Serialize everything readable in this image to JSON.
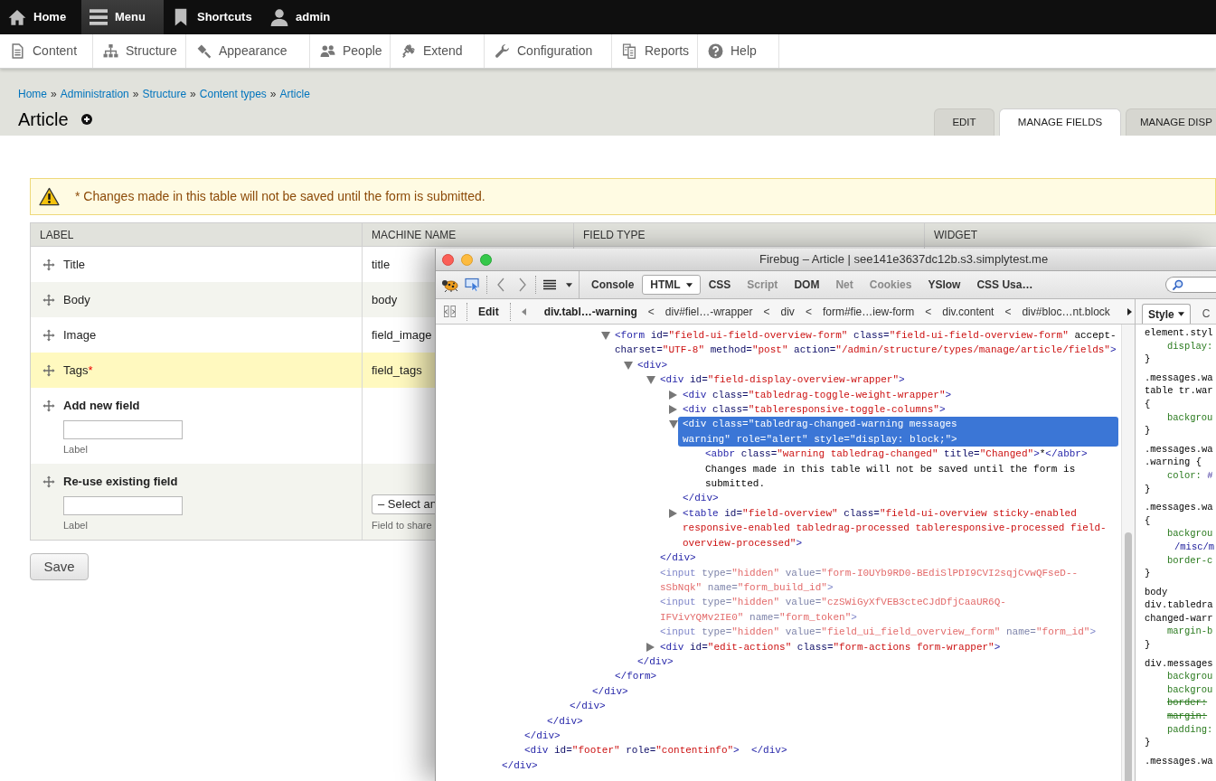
{
  "toolbar": {
    "items": [
      {
        "label": "Home",
        "selected": false
      },
      {
        "label": "Menu",
        "selected": true
      },
      {
        "label": "Shortcuts",
        "selected": false
      },
      {
        "label": "admin",
        "selected": false
      }
    ]
  },
  "tray": {
    "items": [
      {
        "label": "Content"
      },
      {
        "label": "Structure"
      },
      {
        "label": "Appearance"
      },
      {
        "label": "People"
      },
      {
        "label": "Extend"
      },
      {
        "label": "Configuration"
      },
      {
        "label": "Reports"
      },
      {
        "label": "Help"
      }
    ]
  },
  "breadcrumb": {
    "separator": "»",
    "items": [
      "Home",
      "Administration",
      "Structure",
      "Content types",
      "Article"
    ]
  },
  "page_title": "Article",
  "tabs": [
    {
      "label": "EDIT",
      "selected": false
    },
    {
      "label": "MANAGE FIELDS",
      "selected": true
    },
    {
      "label": "MANAGE DISP",
      "selected": false
    }
  ],
  "warning": {
    "text": "* Changes made in this table will not be saved until the form is submitted."
  },
  "table": {
    "columns": [
      "LABEL",
      "MACHINE NAME",
      "FIELD TYPE",
      "WIDGET"
    ],
    "rows": [
      {
        "kind": "field",
        "label": "Title",
        "machine_name": "title",
        "changed": false
      },
      {
        "kind": "field",
        "label": "Body",
        "machine_name": "body",
        "changed": false
      },
      {
        "kind": "field",
        "label": "Image",
        "machine_name": "field_image",
        "changed": false
      },
      {
        "kind": "field",
        "label": "Tags",
        "marker": "*",
        "machine_name": "field_tags",
        "changed": true
      },
      {
        "kind": "add",
        "label": "Add new field",
        "field_description": "Label"
      },
      {
        "kind": "reuse",
        "label": "Re-use existing field",
        "field_description": "Label",
        "select_value": "– Select an",
        "select_description": "Field to share"
      }
    ]
  },
  "save_button": "Save",
  "firebug": {
    "title": "Firebug – Article | see141e3637dc12b.s3.simplytest.me",
    "panels": [
      {
        "label": "Console",
        "selected": false,
        "disabled": false
      },
      {
        "label": "HTML",
        "selected": true,
        "disabled": false
      },
      {
        "label": "CSS",
        "selected": false,
        "disabled": false
      },
      {
        "label": "Script",
        "selected": false,
        "disabled": true
      },
      {
        "label": "DOM",
        "selected": false,
        "disabled": false
      },
      {
        "label": "Net",
        "selected": false,
        "disabled": true
      },
      {
        "label": "Cookies",
        "selected": false,
        "disabled": true
      },
      {
        "label": "YSlow",
        "selected": false,
        "disabled": false
      },
      {
        "label": "CSS Usa…",
        "selected": false,
        "disabled": false
      }
    ],
    "edit_button": "Edit",
    "separator": "<",
    "crumbs": [
      {
        "label": "div.tabl…-warning",
        "selected": true
      },
      {
        "label": "div#fiel…-wrapper",
        "selected": false
      },
      {
        "label": "div",
        "selected": false
      },
      {
        "label": "form#fie…iew-form",
        "selected": false
      },
      {
        "label": "div.content",
        "selected": false
      },
      {
        "label": "div#bloc…nt.block",
        "selected": false
      }
    ],
    "side_tabs": [
      {
        "label": "Style",
        "selected": true
      },
      {
        "label": "C",
        "selected": false
      }
    ],
    "tree": [
      {
        "kind": "element",
        "close": "</div>",
        "children": [
          {
            "kind": "element",
            "close": "</div>",
            "children": [
              {
                "kind": "element",
                "close": "</div>",
                "children": [
                  {
                    "kind": "element",
                    "close": "</div>",
                    "children": [
                      {
                        "kind": "element",
                        "close": "</div>",
                        "children": [
                          {
                            "kind": "element",
                            "expanded": true,
                            "selected": false,
                            "lines": [
                              "<form id=\"field-ui-field-overview-form\" class=\"field-ui-field-overview-form\" accept-",
                              "charset=\"UTF-8\" method=\"post\" action=\"/admin/structure/types/manage/article/fields\">"
                            ],
                            "close": "</form>",
                            "children": [
                              {
                                "kind": "element",
                                "expanded": true,
                                "selected": false,
                                "lines": [
                                  "<div>"
                                ],
                                "close": "</div>",
                                "children": [
                                  {
                                    "kind": "element",
                                    "expanded": true,
                                    "selected": false,
                                    "lines": [
                                      "<div id=\"field-display-overview-wrapper\">"
                                    ],
                                    "close": "</div>",
                                    "children": [
                                      {
                                        "kind": "element",
                                        "expanded": false,
                                        "selected": false,
                                        "lines": [
                                          "<div class=\"tabledrag-toggle-weight-wrapper\">"
                                        ]
                                      },
                                      {
                                        "kind": "element",
                                        "expanded": false,
                                        "selected": false,
                                        "lines": [
                                          "<div class=\"tableresponsive-toggle-columns\">"
                                        ]
                                      },
                                      {
                                        "kind": "element",
                                        "expanded": true,
                                        "selected": true,
                                        "lines": [
                                          "<div class=\"tabledrag-changed-warning messages",
                                          "warning\" role=\"alert\" style=\"display: block;\">"
                                        ],
                                        "close": "</div>",
                                        "children": [
                                          {
                                            "kind": "element",
                                            "selected": false,
                                            "lines": [
                                              "<abbr class=\"warning tabledrag-changed\" title=\"Changed\">*</abbr>"
                                            ]
                                          },
                                          {
                                            "kind": "text",
                                            "selected": false,
                                            "lines": [
                                              "Changes made in this table will not be saved until the form is",
                                              "submitted."
                                            ]
                                          }
                                        ]
                                      },
                                      {
                                        "kind": "element",
                                        "expanded": false,
                                        "selected": false,
                                        "lines": [
                                          "<table id=\"field-overview\" class=\"field-ui-overview sticky-enabled",
                                          "responsive-enabled tabledrag-processed tableresponsive-processed field-",
                                          "overview-processed\">"
                                        ]
                                      }
                                    ]
                                  },
                                  {
                                    "kind": "hidden",
                                    "selected": false,
                                    "lines": [
                                      "<input type=\"hidden\" value=\"form-I0UYb9RD0-BEdiSlPDI9CVI2sqjCvwQFseD--",
                                      "sSbNqk\" name=\"form_build_id\">"
                                    ]
                                  },
                                  {
                                    "kind": "hidden",
                                    "selected": false,
                                    "lines": [
                                      "<input type=\"hidden\" value=\"czSWiGyXfVEB3cteCJdDfjCaaUR6Q-",
                                      "IFVivYQMv2IE0\" name=\"form_token\">"
                                    ]
                                  },
                                  {
                                    "kind": "hidden",
                                    "selected": false,
                                    "lines": [
                                      "<input type=\"hidden\" value=\"field_ui_field_overview_form\" name=\"form_id\">"
                                    ]
                                  },
                                  {
                                    "kind": "element",
                                    "expanded": false,
                                    "selected": false,
                                    "lines": [
                                      "<div id=\"edit-actions\" class=\"form-actions form-wrapper\">"
                                    ]
                                  }
                                ]
                              }
                            ]
                          }
                        ]
                      }
                    ]
                  }
                ]
              }
            ]
          },
          {
            "kind": "element",
            "selected": false,
            "lines": [
              "<div id=\"footer\" role=\"contentinfo\">  </div>"
            ]
          }
        ]
      }
    ],
    "styles": [
      {
        "lines": [
          {
            "kind": "selector",
            "text": "element.styl"
          },
          {
            "kind": "property",
            "name": "display:",
            "overridden": false
          },
          {
            "kind": "brace",
            "text": "}"
          }
        ]
      },
      {
        "lines": [
          {
            "kind": "selector",
            "text": ".messages.wa"
          },
          {
            "kind": "selector",
            "text": "table tr.war"
          },
          {
            "kind": "brace",
            "text": "{"
          },
          {
            "kind": "property",
            "name": "backgrou",
            "overridden": false
          },
          {
            "kind": "brace",
            "text": "}"
          }
        ]
      },
      {
        "lines": [
          {
            "kind": "selector",
            "text": ".messages.wa"
          },
          {
            "kind": "selector",
            "text": ".warning {"
          },
          {
            "kind": "property",
            "name": "color:",
            "value": "#",
            "overridden": false
          },
          {
            "kind": "brace",
            "text": "}"
          }
        ]
      },
      {
        "lines": [
          {
            "kind": "selector",
            "text": ".messages.wa"
          },
          {
            "kind": "brace",
            "text": "{"
          },
          {
            "kind": "property",
            "name": "backgrou",
            "overridden": false
          },
          {
            "kind": "value",
            "text": "/misc/m"
          },
          {
            "kind": "property",
            "name": "border-c",
            "overridden": false
          },
          {
            "kind": "brace",
            "text": "}"
          }
        ]
      },
      {
        "lines": [
          {
            "kind": "selector",
            "text": "body"
          },
          {
            "kind": "selector",
            "text": "div.tabledra"
          },
          {
            "kind": "selector",
            "text": "changed-warr"
          },
          {
            "kind": "property",
            "name": "margin-b",
            "overridden": false
          },
          {
            "kind": "brace",
            "text": "}"
          }
        ]
      },
      {
        "lines": [
          {
            "kind": "selector",
            "text": "div.messages"
          },
          {
            "kind": "property",
            "name": "backgrou",
            "overridden": false
          },
          {
            "kind": "property",
            "name": "backgrou",
            "overridden": false
          },
          {
            "kind": "property",
            "name": "border:",
            "overridden": true
          },
          {
            "kind": "property",
            "name": "margin:",
            "overridden": true
          },
          {
            "kind": "property",
            "name": "padding:",
            "overridden": false
          },
          {
            "kind": "brace",
            "text": "}"
          }
        ]
      },
      {
        "lines": [
          {
            "kind": "selector",
            "text": ".messages.wa"
          }
        ]
      }
    ]
  }
}
